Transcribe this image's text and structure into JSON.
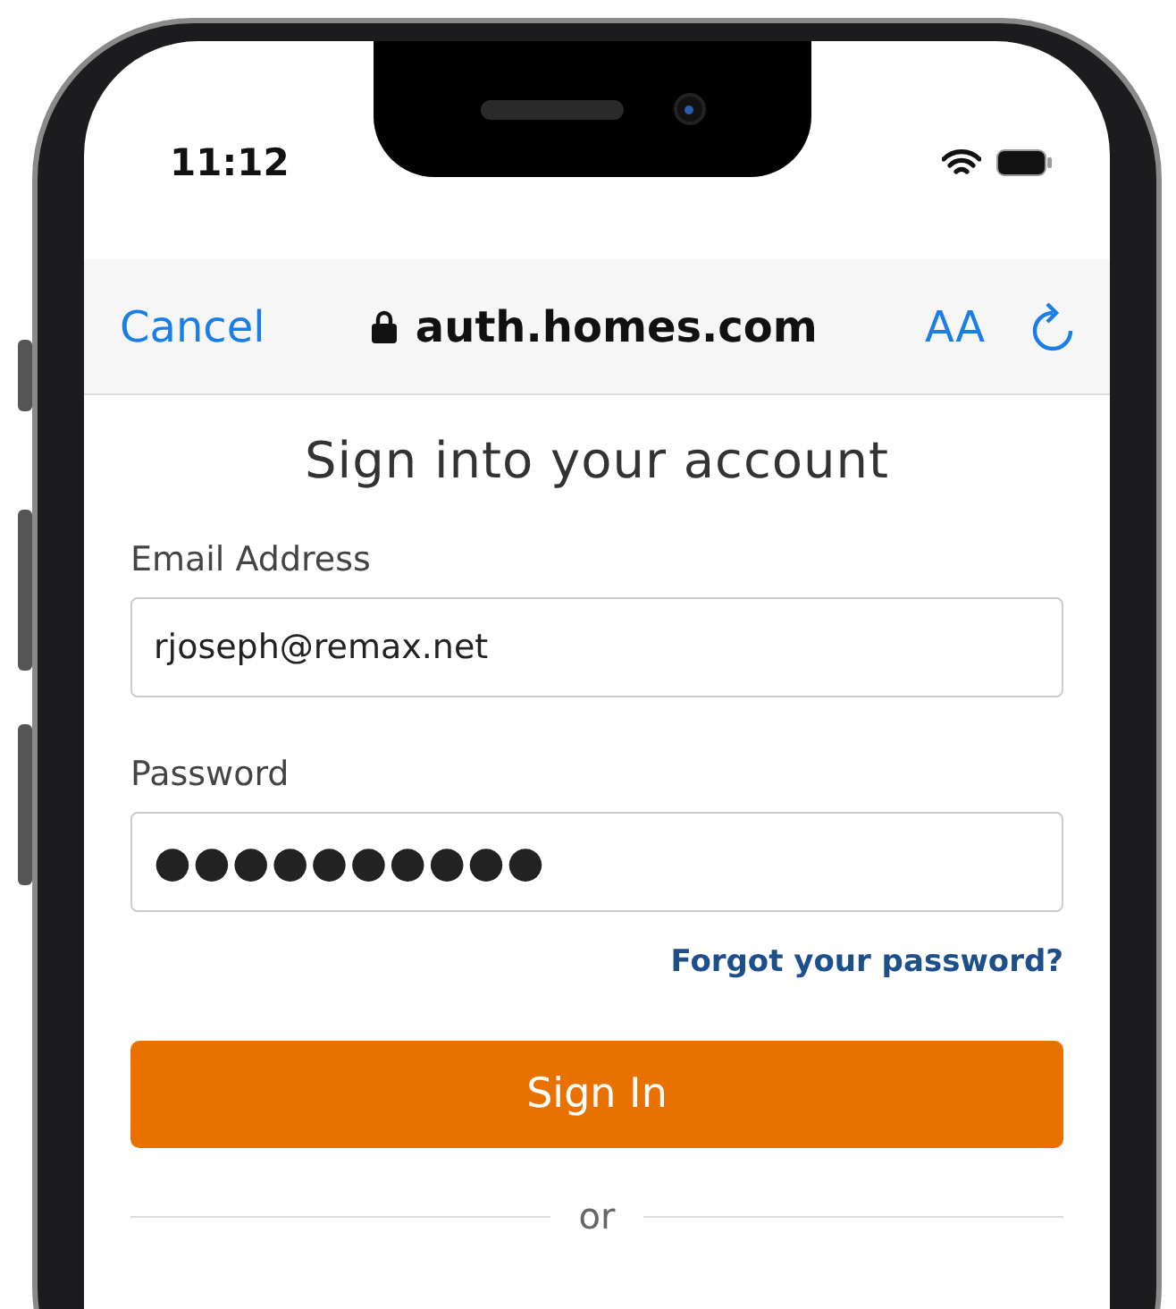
{
  "status_bar": {
    "time": "11:12"
  },
  "browser_bar": {
    "cancel": "Cancel",
    "url": "auth.homes.com",
    "text_size": "AA"
  },
  "form": {
    "title": "Sign into your account",
    "fields": [
      {
        "label": "Email Address",
        "value": "rjoseph@remax.net",
        "kind": "text"
      },
      {
        "label": "Password",
        "value": "●●●●●●●●●●",
        "kind": "password"
      }
    ],
    "forgot_link": "Forgot your password?",
    "submit": "Sign In",
    "divider": "or"
  }
}
